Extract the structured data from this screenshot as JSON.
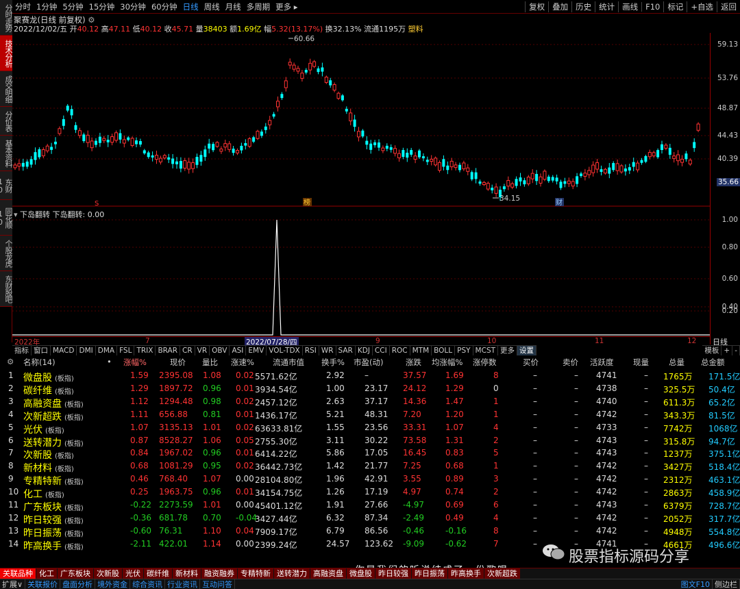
{
  "left_tabs": [
    "分时走势",
    "技术分析",
    "成交明细",
    "分价表",
    "基本资料",
    "东财10",
    "同花顺10",
    "个股龙虎",
    "东财股吧"
  ],
  "toolbar": {
    "periods": [
      "分时",
      "1分钟",
      "5分钟",
      "15分钟",
      "30分钟",
      "60分钟",
      "日线",
      "周线",
      "月线",
      "多周期",
      "更多 ▸"
    ],
    "right": [
      "复权",
      "叠加",
      "历史",
      "统计",
      "画线",
      "F10",
      "标记",
      "+自选",
      "返回"
    ]
  },
  "stock": {
    "title": "聚赛龙(日线 前复权)",
    "date": "2022/12/02/五",
    "open_label": "开",
    "open": "40.12",
    "high_label": "高",
    "high": "47.11",
    "low_label": "低",
    "low": "40.12",
    "close_label": "收",
    "close": "45.71",
    "vol_label": "量",
    "vol": "38403",
    "amt_label": "额",
    "amt": "1.69亿",
    "amp_label": "幅",
    "amp": "5.32(13.17%)",
    "turn_label": "换",
    "turn": "32.13%",
    "float_label": "流通",
    "float": "1195万",
    "sector": "塑料"
  },
  "price_axis": [
    "59.13",
    "53.76",
    "48.87",
    "44.43",
    "40.39"
  ],
  "current_price": "35.66",
  "peak_label": "60.66",
  "trough_label": "34.15",
  "markers": [
    "S",
    "榜",
    "财"
  ],
  "indicator": {
    "title": "下岛翻转",
    "value_label": "下岛翻转: 0.00",
    "axis": [
      "1.00",
      "0.80",
      "0.60",
      "0.40",
      "0.20"
    ]
  },
  "dates": [
    "2022年",
    "7",
    "2022/07/28/四",
    "9",
    "10",
    "11",
    "12"
  ],
  "day_button": "日线",
  "ind_tabs": [
    "指标",
    "窗口",
    "MACD",
    "DMI",
    "DMA",
    "FSL",
    "TRIX",
    "BRAR",
    "CR",
    "VR",
    "OBV",
    "ASI",
    "EMV",
    "VOL-TDX",
    "RSI",
    "WR",
    "SAR",
    "KDJ",
    "CCI",
    "ROC",
    "MTM",
    "BOLL",
    "PSY",
    "MCST",
    "更多",
    "设置"
  ],
  "ind_tabs_right": [
    "模板",
    "+",
    "-"
  ],
  "table": {
    "headers": [
      "名称(14)",
      "•",
      "涨幅%",
      "现价",
      "量比",
      "涨速%",
      "流通市值",
      "换手%",
      "市盈(动)",
      "涨跌",
      "均涨幅%",
      "涨停数",
      "买价",
      "卖价",
      "活跃度",
      "现量",
      "总量",
      "总金额"
    ],
    "tag": "(板指)",
    "rows": [
      {
        "no": "1",
        "name": "微盘股",
        "chg": "1.59",
        "price": "2395.08",
        "lb": "1.08",
        "spd": "0.02",
        "mv": "5571.62亿",
        "turn": "2.92",
        "pe": "–",
        "zd": "37.57",
        "avg": "1.69",
        "zt": "8",
        "buy": "–",
        "sell": "–",
        "act": "4741",
        "xl": "–",
        "vol": "1765万",
        "amt": "171.5亿"
      },
      {
        "no": "2",
        "name": "碳纤维",
        "chg": "1.29",
        "price": "1897.72",
        "lb": "0.96",
        "spd": "0.01",
        "mv": "3934.54亿",
        "turn": "1.00",
        "pe": "23.17",
        "zd": "24.12",
        "avg": "1.29",
        "zt": "0",
        "buy": "–",
        "sell": "–",
        "act": "4738",
        "xl": "–",
        "vol": "325.5万",
        "amt": "50.4亿"
      },
      {
        "no": "3",
        "name": "高融资盘",
        "chg": "1.12",
        "price": "1294.48",
        "lb": "0.98",
        "spd": "0.02",
        "mv": "2457.12亿",
        "turn": "2.63",
        "pe": "37.17",
        "zd": "14.36",
        "avg": "1.47",
        "zt": "1",
        "buy": "–",
        "sell": "–",
        "act": "4740",
        "xl": "–",
        "vol": "611.3万",
        "amt": "65.2亿"
      },
      {
        "no": "4",
        "name": "次新超跌",
        "chg": "1.11",
        "price": "656.88",
        "lb": "0.81",
        "spd": "0.01",
        "mv": "1436.17亿",
        "turn": "5.21",
        "pe": "48.31",
        "zd": "7.20",
        "avg": "1.20",
        "zt": "1",
        "buy": "–",
        "sell": "–",
        "act": "4742",
        "xl": "–",
        "vol": "343.3万",
        "amt": "81.5亿"
      },
      {
        "no": "5",
        "name": "光伏",
        "chg": "1.07",
        "price": "3135.13",
        "lb": "1.01",
        "spd": "0.02",
        "mv": "63633.81亿",
        "turn": "1.55",
        "pe": "23.56",
        "zd": "33.31",
        "avg": "1.07",
        "zt": "4",
        "buy": "–",
        "sell": "–",
        "act": "4733",
        "xl": "–",
        "vol": "7742万",
        "amt": "1068亿"
      },
      {
        "no": "6",
        "name": "送转潜力",
        "chg": "0.87",
        "price": "8528.27",
        "lb": "1.06",
        "spd": "0.05",
        "mv": "2755.30亿",
        "turn": "3.11",
        "pe": "30.22",
        "zd": "73.58",
        "avg": "1.31",
        "zt": "2",
        "buy": "–",
        "sell": "–",
        "act": "4743",
        "xl": "–",
        "vol": "315.8万",
        "amt": "94.7亿"
      },
      {
        "no": "7",
        "name": "次新股",
        "chg": "0.84",
        "price": "1967.02",
        "lb": "0.96",
        "spd": "0.01",
        "mv": "6414.22亿",
        "turn": "5.86",
        "pe": "17.05",
        "zd": "16.45",
        "avg": "0.83",
        "zt": "5",
        "buy": "–",
        "sell": "–",
        "act": "4743",
        "xl": "–",
        "vol": "1237万",
        "amt": "375.1亿"
      },
      {
        "no": "8",
        "name": "新材料",
        "chg": "0.68",
        "price": "1081.29",
        "lb": "0.95",
        "spd": "0.02",
        "mv": "36442.73亿",
        "turn": "1.42",
        "pe": "21.77",
        "zd": "7.25",
        "avg": "0.68",
        "zt": "1",
        "buy": "–",
        "sell": "–",
        "act": "4742",
        "xl": "–",
        "vol": "3427万",
        "amt": "518.4亿"
      },
      {
        "no": "9",
        "name": "专精特新",
        "chg": "0.46",
        "price": "768.40",
        "lb": "1.07",
        "spd": "0.00",
        "mv": "28104.80亿",
        "turn": "1.96",
        "pe": "42.91",
        "zd": "3.55",
        "avg": "0.89",
        "zt": "3",
        "buy": "–",
        "sell": "–",
        "act": "4742",
        "xl": "–",
        "vol": "2312万",
        "amt": "463.1亿"
      },
      {
        "no": "10",
        "name": "化工",
        "chg": "0.25",
        "price": "1963.75",
        "lb": "0.96",
        "spd": "0.01",
        "mv": "34154.75亿",
        "turn": "1.26",
        "pe": "17.19",
        "zd": "4.97",
        "avg": "0.74",
        "zt": "2",
        "buy": "–",
        "sell": "–",
        "act": "4742",
        "xl": "–",
        "vol": "2863万",
        "amt": "458.9亿"
      },
      {
        "no": "11",
        "name": "广东板块",
        "chg": "-0.22",
        "price": "2273.59",
        "lb": "1.01",
        "spd": "0.00",
        "mv": "45401.12亿",
        "turn": "1.91",
        "pe": "27.66",
        "zd": "-4.97",
        "avg": "0.69",
        "zt": "6",
        "buy": "–",
        "sell": "–",
        "act": "4743",
        "xl": "–",
        "vol": "6379万",
        "amt": "728.7亿"
      },
      {
        "no": "12",
        "name": "昨日较强",
        "chg": "-0.36",
        "price": "681.78",
        "lb": "0.70",
        "spd": "-0.04",
        "mv": "3427.44亿",
        "turn": "6.32",
        "pe": "87.34",
        "zd": "-2.49",
        "avg": "0.49",
        "zt": "4",
        "buy": "–",
        "sell": "–",
        "act": "4742",
        "xl": "–",
        "vol": "2052万",
        "amt": "317.7亿"
      },
      {
        "no": "13",
        "name": "昨日振荡",
        "chg": "-0.60",
        "price": "76.31",
        "lb": "1.10",
        "spd": "0.04",
        "mv": "7909.17亿",
        "turn": "6.79",
        "pe": "86.56",
        "zd": "-0.46",
        "avg": "-0.16",
        "zt": "8",
        "buy": "–",
        "sell": "–",
        "act": "4742",
        "xl": "–",
        "vol": "4948万",
        "amt": "554.8亿"
      },
      {
        "no": "14",
        "name": "昨高换手",
        "chg": "-2.11",
        "price": "422.01",
        "lb": "1.14",
        "spd": "0.00",
        "mv": "2399.24亿",
        "turn": "24.57",
        "pe": "123.62",
        "zd": "-9.09",
        "avg": "-0.62",
        "zt": "7",
        "buy": "–",
        "sell": "–",
        "act": "4741",
        "xl": "–",
        "vol": "4661万",
        "amt": "496.6亿"
      }
    ]
  },
  "bottom_tabs": [
    "关联品种",
    "化工",
    "广东板块",
    "次新股",
    "光伏",
    "碳纤维",
    "新材料",
    "融资融券",
    "专精特新",
    "送转潜力",
    "高融资盘",
    "微盘股",
    "昨日较强",
    "昨日振荡",
    "昨高换手",
    "次新超跌"
  ],
  "watermark": {
    "text": "股票指标源码分享",
    "overlay": "你是我们的听说结成了一份歌唱"
  },
  "status": [
    "扩展∨",
    "关联报价",
    "盘面分析",
    "境外资金",
    "综合资讯",
    "行业资讯",
    "互动问答"
  ],
  "status_right": [
    "图文F10",
    "侧边栏"
  ],
  "colors": {
    "up": "#ff3333",
    "down": "#22cc22",
    "neutral": "#dddddd",
    "name": "#ffff00",
    "accent": "#3399ff",
    "candle_down": "#00ffff"
  }
}
